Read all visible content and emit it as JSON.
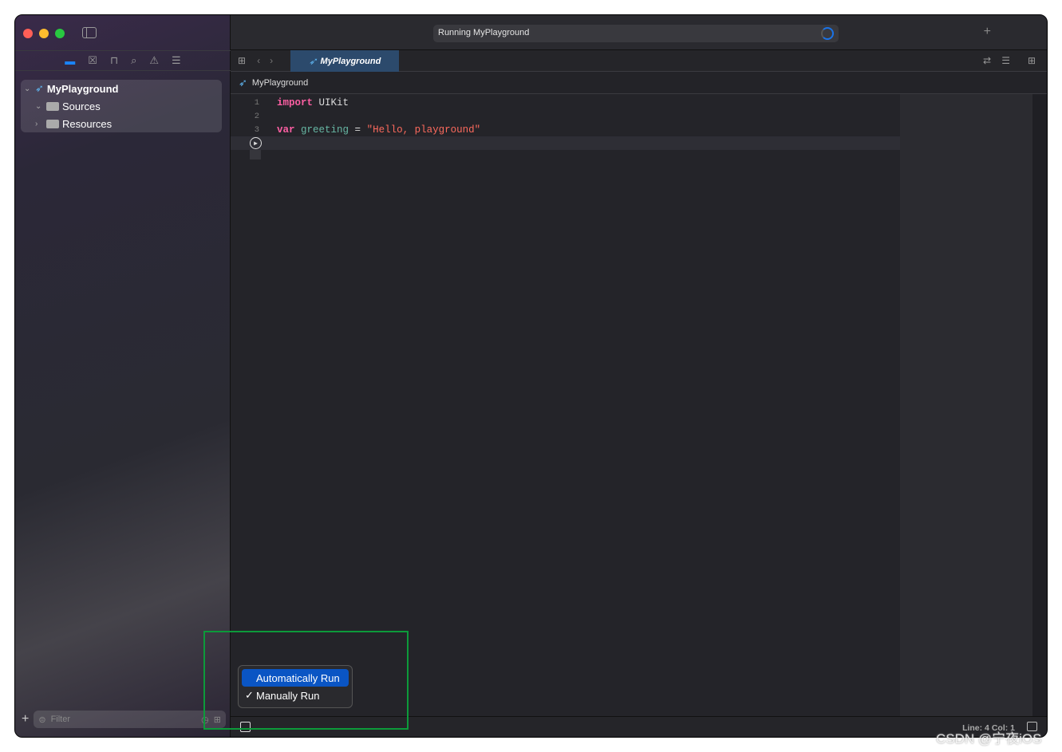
{
  "window": {
    "activity_text": "Running MyPlayground"
  },
  "navigator": {
    "icons": [
      "folder-icon",
      "source-control-icon",
      "hierarchy-icon",
      "search-icon",
      "warning-icon",
      "report-icon"
    ],
    "tree": [
      {
        "label": "MyPlayground",
        "expanded": true
      },
      {
        "label": "Sources",
        "expanded": true
      },
      {
        "label": "Resources",
        "expanded": false
      }
    ],
    "filter_placeholder": "Filter"
  },
  "editor": {
    "tab_label": "MyPlayground",
    "breadcrumb": "MyPlayground",
    "lines": [
      {
        "n": "1",
        "kw": "import",
        "rest": " UIKit"
      },
      {
        "n": "2"
      },
      {
        "n": "3",
        "kw": "var",
        "name": "greeting",
        "op": " = ",
        "str": "\"Hello, playground\""
      }
    ]
  },
  "run_menu": {
    "items": [
      {
        "label": "Automatically Run",
        "highlighted": true,
        "checked": false
      },
      {
        "label": "Manually Run",
        "highlighted": false,
        "checked": true
      }
    ],
    "check": "✓"
  },
  "status": {
    "position": "Line: 4  Col: 1"
  },
  "watermark": "CSDN @宁夜iOS",
  "colors": {
    "accent": "#0a55c4",
    "highlight_box": "#0c9a3a",
    "keyword": "#fc5fa3",
    "string": "#fc6a5d"
  }
}
